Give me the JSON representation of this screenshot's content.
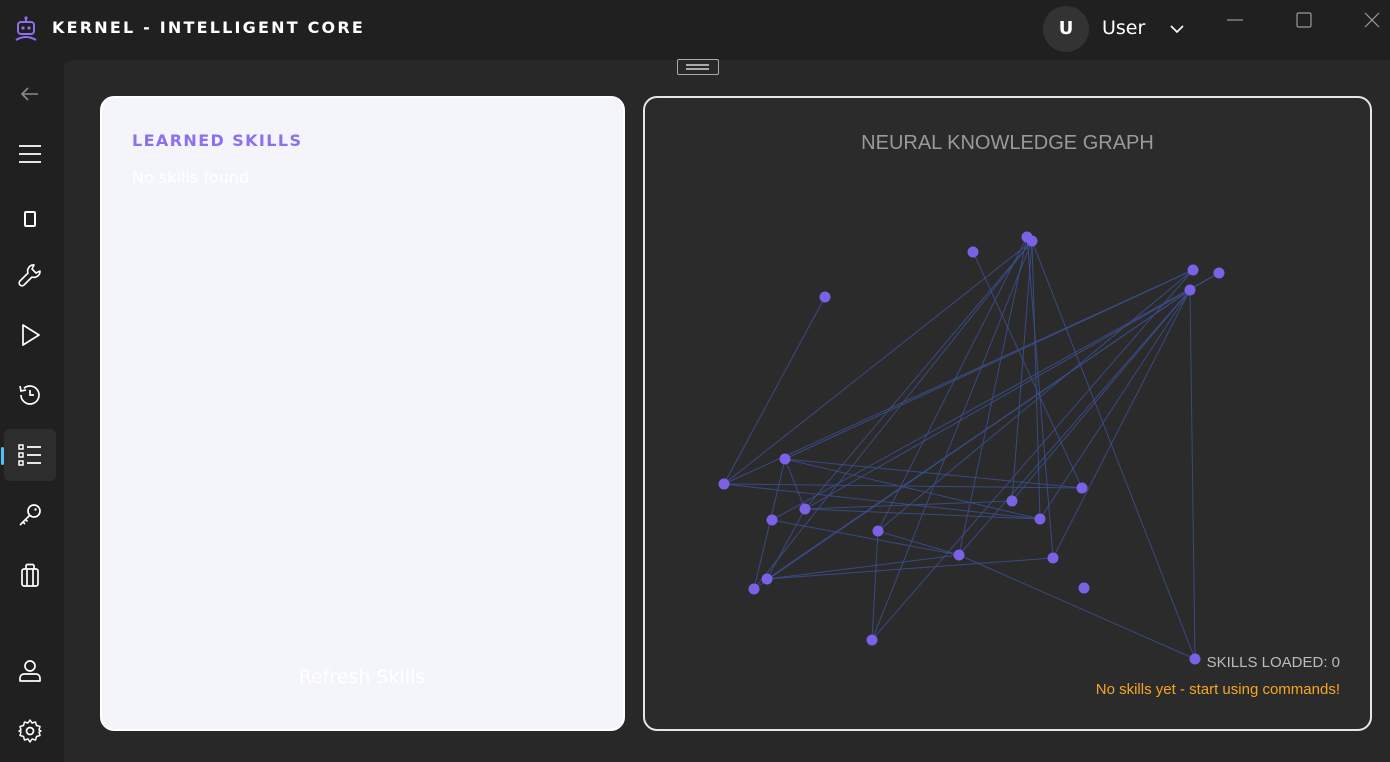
{
  "app": {
    "title": "KERNEL - INTELLIGENT CORE",
    "logo_icon": "robot-icon",
    "accent_color": "#8d6ff0"
  },
  "user": {
    "initial": "U",
    "name": "User"
  },
  "sidebar": {
    "items": [
      {
        "icon": "back-arrow-icon",
        "active": false
      },
      {
        "icon": "hamburger-menu-icon",
        "active": false
      },
      {
        "icon": "phone-icon",
        "active": false
      },
      {
        "icon": "wrench-icon",
        "active": false
      },
      {
        "icon": "play-icon",
        "active": false
      },
      {
        "icon": "history-icon",
        "active": false
      },
      {
        "icon": "list-icon",
        "active": true
      },
      {
        "icon": "key-icon",
        "active": false
      },
      {
        "icon": "gift-icon",
        "active": false
      },
      {
        "icon": "person-icon",
        "active": false
      },
      {
        "icon": "settings-icon",
        "active": false
      }
    ]
  },
  "skills_panel": {
    "title": "LEARNED SKILLS",
    "empty_text": "No skills found",
    "refresh_label": "Refresh Skills"
  },
  "graph_panel": {
    "title": "NEURAL KNOWLEDGE GRAPH",
    "skills_loaded": "SKILLS LOADED: 0",
    "hint": "No skills yet - start using commands!",
    "node_color": "#7b61e6",
    "edge_color": "#3b4e8c",
    "hint_color": "#f5a623"
  }
}
